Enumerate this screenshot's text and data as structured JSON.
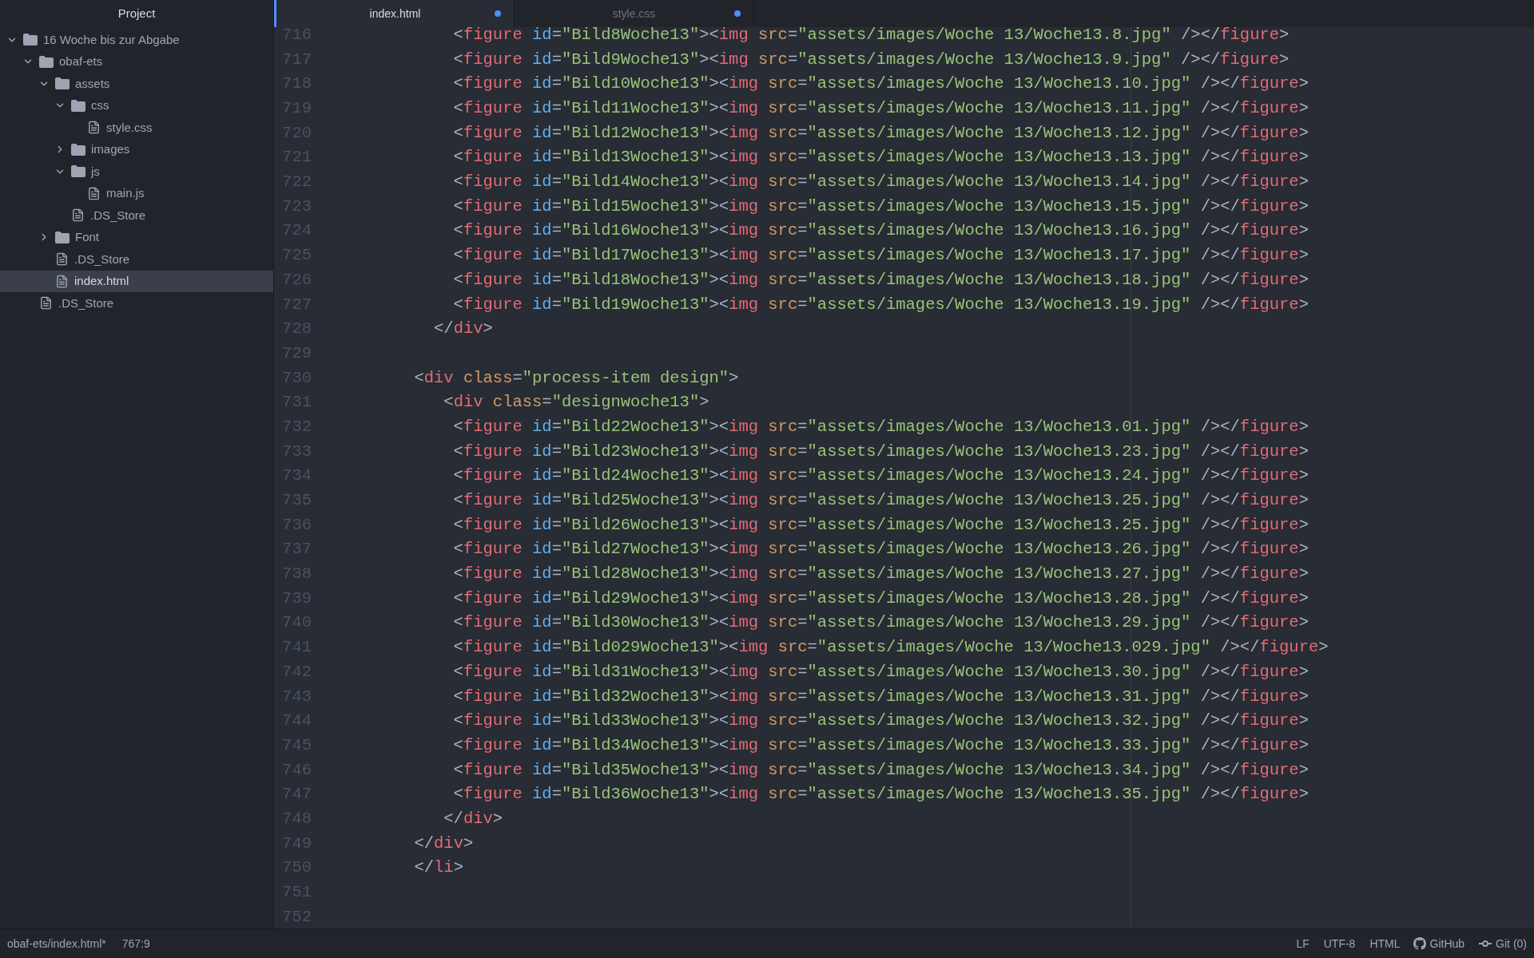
{
  "sidebar": {
    "title": "Project",
    "tree": [
      {
        "kind": "folder",
        "name": "16 Woche bis zur Abgabe",
        "expanded": true,
        "selected": false,
        "children": [
          {
            "kind": "folder",
            "name": "obaf-ets",
            "expanded": true,
            "selected": false,
            "children": [
              {
                "kind": "folder",
                "name": "assets",
                "expanded": true,
                "selected": false,
                "children": [
                  {
                    "kind": "folder",
                    "name": "css",
                    "expanded": true,
                    "selected": false,
                    "children": [
                      {
                        "kind": "file",
                        "name": "style.css",
                        "selected": false
                      }
                    ]
                  },
                  {
                    "kind": "folder",
                    "name": "images",
                    "expanded": false,
                    "selected": false
                  },
                  {
                    "kind": "folder",
                    "name": "js",
                    "expanded": true,
                    "selected": false,
                    "children": [
                      {
                        "kind": "file",
                        "name": "main.js",
                        "selected": false
                      }
                    ]
                  },
                  {
                    "kind": "file",
                    "name": ".DS_Store",
                    "selected": false
                  }
                ]
              },
              {
                "kind": "folder",
                "name": "Font",
                "expanded": false,
                "selected": false
              },
              {
                "kind": "file",
                "name": ".DS_Store",
                "selected": false
              },
              {
                "kind": "file",
                "name": "index.html",
                "selected": true
              }
            ]
          },
          {
            "kind": "file",
            "name": ".DS_Store",
            "selected": false
          }
        ]
      }
    ]
  },
  "tabs": [
    {
      "label": "index.html",
      "selected": true,
      "modified": true
    },
    {
      "label": "style.css",
      "selected": false,
      "modified": true
    }
  ],
  "editor": {
    "lines": [
      {
        "n": "716",
        "code": [
          {
            "kind": "p",
            "text": "            <"
          },
          {
            "kind": "tag",
            "text": "figure"
          },
          {
            "kind": "id",
            "text": " id"
          },
          {
            "kind": "p",
            "text": "="
          },
          {
            "kind": "s",
            "text": "\"Bild8Woche13\""
          },
          {
            "kind": "p",
            "text": "><"
          },
          {
            "kind": "tag",
            "text": "img"
          },
          {
            "kind": "attr",
            "text": " src"
          },
          {
            "kind": "p",
            "text": "="
          },
          {
            "kind": "s",
            "text": "\"assets/images/Woche 13/Woche13.8.jpg\""
          },
          {
            "kind": "p",
            "text": " /></"
          },
          {
            "kind": "tag",
            "text": "figure"
          },
          {
            "kind": "p",
            "text": ">"
          }
        ]
      },
      {
        "n": "717",
        "code": [
          {
            "kind": "p",
            "text": "            <"
          },
          {
            "kind": "tag",
            "text": "figure"
          },
          {
            "kind": "id",
            "text": " id"
          },
          {
            "kind": "p",
            "text": "="
          },
          {
            "kind": "s",
            "text": "\"Bild9Woche13\""
          },
          {
            "kind": "p",
            "text": "><"
          },
          {
            "kind": "tag",
            "text": "img"
          },
          {
            "kind": "attr",
            "text": " src"
          },
          {
            "kind": "p",
            "text": "="
          },
          {
            "kind": "s",
            "text": "\"assets/images/Woche 13/Woche13.9.jpg\""
          },
          {
            "kind": "p",
            "text": " /></"
          },
          {
            "kind": "tag",
            "text": "figure"
          },
          {
            "kind": "p",
            "text": ">"
          }
        ]
      },
      {
        "n": "718",
        "code": [
          {
            "kind": "p",
            "text": "            <"
          },
          {
            "kind": "tag",
            "text": "figure"
          },
          {
            "kind": "id",
            "text": " id"
          },
          {
            "kind": "p",
            "text": "="
          },
          {
            "kind": "s",
            "text": "\"Bild10Woche13\""
          },
          {
            "kind": "p",
            "text": "><"
          },
          {
            "kind": "tag",
            "text": "img"
          },
          {
            "kind": "attr",
            "text": " src"
          },
          {
            "kind": "p",
            "text": "="
          },
          {
            "kind": "s",
            "text": "\"assets/images/Woche 13/Woche13.10.jpg\""
          },
          {
            "kind": "p",
            "text": " /></"
          },
          {
            "kind": "tag",
            "text": "figure"
          },
          {
            "kind": "p",
            "text": ">"
          }
        ]
      },
      {
        "n": "719",
        "code": [
          {
            "kind": "p",
            "text": "            <"
          },
          {
            "kind": "tag",
            "text": "figure"
          },
          {
            "kind": "id",
            "text": " id"
          },
          {
            "kind": "p",
            "text": "="
          },
          {
            "kind": "s",
            "text": "\"Bild11Woche13\""
          },
          {
            "kind": "p",
            "text": "><"
          },
          {
            "kind": "tag",
            "text": "img"
          },
          {
            "kind": "attr",
            "text": " src"
          },
          {
            "kind": "p",
            "text": "="
          },
          {
            "kind": "s",
            "text": "\"assets/images/Woche 13/Woche13.11.jpg\""
          },
          {
            "kind": "p",
            "text": " /></"
          },
          {
            "kind": "tag",
            "text": "figure"
          },
          {
            "kind": "p",
            "text": ">"
          }
        ]
      },
      {
        "n": "720",
        "code": [
          {
            "kind": "p",
            "text": "            <"
          },
          {
            "kind": "tag",
            "text": "figure"
          },
          {
            "kind": "id",
            "text": " id"
          },
          {
            "kind": "p",
            "text": "="
          },
          {
            "kind": "s",
            "text": "\"Bild12Woche13\""
          },
          {
            "kind": "p",
            "text": "><"
          },
          {
            "kind": "tag",
            "text": "img"
          },
          {
            "kind": "attr",
            "text": " src"
          },
          {
            "kind": "p",
            "text": "="
          },
          {
            "kind": "s",
            "text": "\"assets/images/Woche 13/Woche13.12.jpg\""
          },
          {
            "kind": "p",
            "text": " /></"
          },
          {
            "kind": "tag",
            "text": "figure"
          },
          {
            "kind": "p",
            "text": ">"
          }
        ]
      },
      {
        "n": "721",
        "code": [
          {
            "kind": "p",
            "text": "            <"
          },
          {
            "kind": "tag",
            "text": "figure"
          },
          {
            "kind": "id",
            "text": " id"
          },
          {
            "kind": "p",
            "text": "="
          },
          {
            "kind": "s",
            "text": "\"Bild13Woche13\""
          },
          {
            "kind": "p",
            "text": "><"
          },
          {
            "kind": "tag",
            "text": "img"
          },
          {
            "kind": "attr",
            "text": " src"
          },
          {
            "kind": "p",
            "text": "="
          },
          {
            "kind": "s",
            "text": "\"assets/images/Woche 13/Woche13.13.jpg\""
          },
          {
            "kind": "p",
            "text": " /></"
          },
          {
            "kind": "tag",
            "text": "figure"
          },
          {
            "kind": "p",
            "text": ">"
          }
        ]
      },
      {
        "n": "722",
        "code": [
          {
            "kind": "p",
            "text": "            <"
          },
          {
            "kind": "tag",
            "text": "figure"
          },
          {
            "kind": "id",
            "text": " id"
          },
          {
            "kind": "p",
            "text": "="
          },
          {
            "kind": "s",
            "text": "\"Bild14Woche13\""
          },
          {
            "kind": "p",
            "text": "><"
          },
          {
            "kind": "tag",
            "text": "img"
          },
          {
            "kind": "attr",
            "text": " src"
          },
          {
            "kind": "p",
            "text": "="
          },
          {
            "kind": "s",
            "text": "\"assets/images/Woche 13/Woche13.14.jpg\""
          },
          {
            "kind": "p",
            "text": " /></"
          },
          {
            "kind": "tag",
            "text": "figure"
          },
          {
            "kind": "p",
            "text": ">"
          }
        ]
      },
      {
        "n": "723",
        "code": [
          {
            "kind": "p",
            "text": "            <"
          },
          {
            "kind": "tag",
            "text": "figure"
          },
          {
            "kind": "id",
            "text": " id"
          },
          {
            "kind": "p",
            "text": "="
          },
          {
            "kind": "s",
            "text": "\"Bild15Woche13\""
          },
          {
            "kind": "p",
            "text": "><"
          },
          {
            "kind": "tag",
            "text": "img"
          },
          {
            "kind": "attr",
            "text": " src"
          },
          {
            "kind": "p",
            "text": "="
          },
          {
            "kind": "s",
            "text": "\"assets/images/Woche 13/Woche13.15.jpg\""
          },
          {
            "kind": "p",
            "text": " /></"
          },
          {
            "kind": "tag",
            "text": "figure"
          },
          {
            "kind": "p",
            "text": ">"
          }
        ]
      },
      {
        "n": "724",
        "code": [
          {
            "kind": "p",
            "text": "            <"
          },
          {
            "kind": "tag",
            "text": "figure"
          },
          {
            "kind": "id",
            "text": " id"
          },
          {
            "kind": "p",
            "text": "="
          },
          {
            "kind": "s",
            "text": "\"Bild16Woche13\""
          },
          {
            "kind": "p",
            "text": "><"
          },
          {
            "kind": "tag",
            "text": "img"
          },
          {
            "kind": "attr",
            "text": " src"
          },
          {
            "kind": "p",
            "text": "="
          },
          {
            "kind": "s",
            "text": "\"assets/images/Woche 13/Woche13.16.jpg\""
          },
          {
            "kind": "p",
            "text": " /></"
          },
          {
            "kind": "tag",
            "text": "figure"
          },
          {
            "kind": "p",
            "text": ">"
          }
        ]
      },
      {
        "n": "725",
        "code": [
          {
            "kind": "p",
            "text": "            <"
          },
          {
            "kind": "tag",
            "text": "figure"
          },
          {
            "kind": "id",
            "text": " id"
          },
          {
            "kind": "p",
            "text": "="
          },
          {
            "kind": "s",
            "text": "\"Bild17Woche13\""
          },
          {
            "kind": "p",
            "text": "><"
          },
          {
            "kind": "tag",
            "text": "img"
          },
          {
            "kind": "attr",
            "text": " src"
          },
          {
            "kind": "p",
            "text": "="
          },
          {
            "kind": "s",
            "text": "\"assets/images/Woche 13/Woche13.17.jpg\""
          },
          {
            "kind": "p",
            "text": " /></"
          },
          {
            "kind": "tag",
            "text": "figure"
          },
          {
            "kind": "p",
            "text": ">"
          }
        ]
      },
      {
        "n": "726",
        "code": [
          {
            "kind": "p",
            "text": "            <"
          },
          {
            "kind": "tag",
            "text": "figure"
          },
          {
            "kind": "id",
            "text": " id"
          },
          {
            "kind": "p",
            "text": "="
          },
          {
            "kind": "s",
            "text": "\"Bild18Woche13\""
          },
          {
            "kind": "p",
            "text": "><"
          },
          {
            "kind": "tag",
            "text": "img"
          },
          {
            "kind": "attr",
            "text": " src"
          },
          {
            "kind": "p",
            "text": "="
          },
          {
            "kind": "s",
            "text": "\"assets/images/Woche 13/Woche13.18.jpg\""
          },
          {
            "kind": "p",
            "text": " /></"
          },
          {
            "kind": "tag",
            "text": "figure"
          },
          {
            "kind": "p",
            "text": ">"
          }
        ]
      },
      {
        "n": "727",
        "code": [
          {
            "kind": "p",
            "text": "            <"
          },
          {
            "kind": "tag",
            "text": "figure"
          },
          {
            "kind": "id",
            "text": " id"
          },
          {
            "kind": "p",
            "text": "="
          },
          {
            "kind": "s",
            "text": "\"Bild19Woche13\""
          },
          {
            "kind": "p",
            "text": "><"
          },
          {
            "kind": "tag",
            "text": "img"
          },
          {
            "kind": "attr",
            "text": " src"
          },
          {
            "kind": "p",
            "text": "="
          },
          {
            "kind": "s",
            "text": "\"assets/images/Woche 13/Woche13.19.jpg\""
          },
          {
            "kind": "p",
            "text": " /></"
          },
          {
            "kind": "tag",
            "text": "figure"
          },
          {
            "kind": "p",
            "text": ">"
          }
        ]
      },
      {
        "n": "728",
        "code": [
          {
            "kind": "p",
            "text": "          </"
          },
          {
            "kind": "tag",
            "text": "div"
          },
          {
            "kind": "p",
            "text": ">"
          }
        ]
      },
      {
        "n": "729"
      },
      {
        "n": "730",
        "code": [
          {
            "kind": "p",
            "text": "        <"
          },
          {
            "kind": "tag",
            "text": "div"
          },
          {
            "kind": "attr",
            "text": " class"
          },
          {
            "kind": "p",
            "text": "="
          },
          {
            "kind": "s",
            "text": "\"process-item design\""
          },
          {
            "kind": "p",
            "text": ">"
          }
        ]
      },
      {
        "n": "731",
        "code": [
          {
            "kind": "p",
            "text": "           <"
          },
          {
            "kind": "tag",
            "text": "div"
          },
          {
            "kind": "attr",
            "text": " class"
          },
          {
            "kind": "p",
            "text": "="
          },
          {
            "kind": "s",
            "text": "\"designwoche13\""
          },
          {
            "kind": "p",
            "text": ">"
          }
        ]
      },
      {
        "n": "732",
        "code": [
          {
            "kind": "p",
            "text": "            <"
          },
          {
            "kind": "tag",
            "text": "figure"
          },
          {
            "kind": "id",
            "text": " id"
          },
          {
            "kind": "p",
            "text": "="
          },
          {
            "kind": "s",
            "text": "\"Bild22Woche13\""
          },
          {
            "kind": "p",
            "text": "><"
          },
          {
            "kind": "tag",
            "text": "img"
          },
          {
            "kind": "attr",
            "text": " src"
          },
          {
            "kind": "p",
            "text": "="
          },
          {
            "kind": "s",
            "text": "\"assets/images/Woche 13/Woche13.01.jpg\""
          },
          {
            "kind": "p",
            "text": " /></"
          },
          {
            "kind": "tag",
            "text": "figure"
          },
          {
            "kind": "p",
            "text": ">"
          }
        ]
      },
      {
        "n": "733",
        "code": [
          {
            "kind": "p",
            "text": "            <"
          },
          {
            "kind": "tag",
            "text": "figure"
          },
          {
            "kind": "id",
            "text": " id"
          },
          {
            "kind": "p",
            "text": "="
          },
          {
            "kind": "s",
            "text": "\"Bild23Woche13\""
          },
          {
            "kind": "p",
            "text": "><"
          },
          {
            "kind": "tag",
            "text": "img"
          },
          {
            "kind": "attr",
            "text": " src"
          },
          {
            "kind": "p",
            "text": "="
          },
          {
            "kind": "s",
            "text": "\"assets/images/Woche 13/Woche13.23.jpg\""
          },
          {
            "kind": "p",
            "text": " /></"
          },
          {
            "kind": "tag",
            "text": "figure"
          },
          {
            "kind": "p",
            "text": ">"
          }
        ]
      },
      {
        "n": "734",
        "code": [
          {
            "kind": "p",
            "text": "            <"
          },
          {
            "kind": "tag",
            "text": "figure"
          },
          {
            "kind": "id",
            "text": " id"
          },
          {
            "kind": "p",
            "text": "="
          },
          {
            "kind": "s",
            "text": "\"Bild24Woche13\""
          },
          {
            "kind": "p",
            "text": "><"
          },
          {
            "kind": "tag",
            "text": "img"
          },
          {
            "kind": "attr",
            "text": " src"
          },
          {
            "kind": "p",
            "text": "="
          },
          {
            "kind": "s",
            "text": "\"assets/images/Woche 13/Woche13.24.jpg\""
          },
          {
            "kind": "p",
            "text": " /></"
          },
          {
            "kind": "tag",
            "text": "figure"
          },
          {
            "kind": "p",
            "text": ">"
          }
        ]
      },
      {
        "n": "735",
        "code": [
          {
            "kind": "p",
            "text": "            <"
          },
          {
            "kind": "tag",
            "text": "figure"
          },
          {
            "kind": "id",
            "text": " id"
          },
          {
            "kind": "p",
            "text": "="
          },
          {
            "kind": "s",
            "text": "\"Bild25Woche13\""
          },
          {
            "kind": "p",
            "text": "><"
          },
          {
            "kind": "tag",
            "text": "img"
          },
          {
            "kind": "attr",
            "text": " src"
          },
          {
            "kind": "p",
            "text": "="
          },
          {
            "kind": "s",
            "text": "\"assets/images/Woche 13/Woche13.25.jpg\""
          },
          {
            "kind": "p",
            "text": " /></"
          },
          {
            "kind": "tag",
            "text": "figure"
          },
          {
            "kind": "p",
            "text": ">"
          }
        ]
      },
      {
        "n": "736",
        "code": [
          {
            "kind": "p",
            "text": "            <"
          },
          {
            "kind": "tag",
            "text": "figure"
          },
          {
            "kind": "id",
            "text": " id"
          },
          {
            "kind": "p",
            "text": "="
          },
          {
            "kind": "s",
            "text": "\"Bild26Woche13\""
          },
          {
            "kind": "p",
            "text": "><"
          },
          {
            "kind": "tag",
            "text": "img"
          },
          {
            "kind": "attr",
            "text": " src"
          },
          {
            "kind": "p",
            "text": "="
          },
          {
            "kind": "s",
            "text": "\"assets/images/Woche 13/Woche13.25.jpg\""
          },
          {
            "kind": "p",
            "text": " /></"
          },
          {
            "kind": "tag",
            "text": "figure"
          },
          {
            "kind": "p",
            "text": ">"
          }
        ]
      },
      {
        "n": "737",
        "code": [
          {
            "kind": "p",
            "text": "            <"
          },
          {
            "kind": "tag",
            "text": "figure"
          },
          {
            "kind": "id",
            "text": " id"
          },
          {
            "kind": "p",
            "text": "="
          },
          {
            "kind": "s",
            "text": "\"Bild27Woche13\""
          },
          {
            "kind": "p",
            "text": "><"
          },
          {
            "kind": "tag",
            "text": "img"
          },
          {
            "kind": "attr",
            "text": " src"
          },
          {
            "kind": "p",
            "text": "="
          },
          {
            "kind": "s",
            "text": "\"assets/images/Woche 13/Woche13.26.jpg\""
          },
          {
            "kind": "p",
            "text": " /></"
          },
          {
            "kind": "tag",
            "text": "figure"
          },
          {
            "kind": "p",
            "text": ">"
          }
        ]
      },
      {
        "n": "738",
        "code": [
          {
            "kind": "p",
            "text": "            <"
          },
          {
            "kind": "tag",
            "text": "figure"
          },
          {
            "kind": "id",
            "text": " id"
          },
          {
            "kind": "p",
            "text": "="
          },
          {
            "kind": "s",
            "text": "\"Bild28Woche13\""
          },
          {
            "kind": "p",
            "text": "><"
          },
          {
            "kind": "tag",
            "text": "img"
          },
          {
            "kind": "attr",
            "text": " src"
          },
          {
            "kind": "p",
            "text": "="
          },
          {
            "kind": "s",
            "text": "\"assets/images/Woche 13/Woche13.27.jpg\""
          },
          {
            "kind": "p",
            "text": " /></"
          },
          {
            "kind": "tag",
            "text": "figure"
          },
          {
            "kind": "p",
            "text": ">"
          }
        ]
      },
      {
        "n": "739",
        "code": [
          {
            "kind": "p",
            "text": "            <"
          },
          {
            "kind": "tag",
            "text": "figure"
          },
          {
            "kind": "id",
            "text": " id"
          },
          {
            "kind": "p",
            "text": "="
          },
          {
            "kind": "s",
            "text": "\"Bild29Woche13\""
          },
          {
            "kind": "p",
            "text": "><"
          },
          {
            "kind": "tag",
            "text": "img"
          },
          {
            "kind": "attr",
            "text": " src"
          },
          {
            "kind": "p",
            "text": "="
          },
          {
            "kind": "s",
            "text": "\"assets/images/Woche 13/Woche13.28.jpg\""
          },
          {
            "kind": "p",
            "text": " /></"
          },
          {
            "kind": "tag",
            "text": "figure"
          },
          {
            "kind": "p",
            "text": ">"
          }
        ]
      },
      {
        "n": "740",
        "code": [
          {
            "kind": "p",
            "text": "            <"
          },
          {
            "kind": "tag",
            "text": "figure"
          },
          {
            "kind": "id",
            "text": " id"
          },
          {
            "kind": "p",
            "text": "="
          },
          {
            "kind": "s",
            "text": "\"Bild30Woche13\""
          },
          {
            "kind": "p",
            "text": "><"
          },
          {
            "kind": "tag",
            "text": "img"
          },
          {
            "kind": "attr",
            "text": " src"
          },
          {
            "kind": "p",
            "text": "="
          },
          {
            "kind": "s",
            "text": "\"assets/images/Woche 13/Woche13.29.jpg\""
          },
          {
            "kind": "p",
            "text": " /></"
          },
          {
            "kind": "tag",
            "text": "figure"
          },
          {
            "kind": "p",
            "text": ">"
          }
        ]
      },
      {
        "n": "741",
        "code": [
          {
            "kind": "p",
            "text": "            <"
          },
          {
            "kind": "tag",
            "text": "figure"
          },
          {
            "kind": "id",
            "text": " id"
          },
          {
            "kind": "p",
            "text": "="
          },
          {
            "kind": "s",
            "text": "\"Bild029Woche13\""
          },
          {
            "kind": "p",
            "text": "><"
          },
          {
            "kind": "tag",
            "text": "img"
          },
          {
            "kind": "attr",
            "text": " src"
          },
          {
            "kind": "p",
            "text": "="
          },
          {
            "kind": "s",
            "text": "\"assets/images/Woche 13/Woche13.029.jpg\""
          },
          {
            "kind": "p",
            "text": " /></"
          },
          {
            "kind": "tag",
            "text": "figure"
          },
          {
            "kind": "p",
            "text": ">"
          }
        ]
      },
      {
        "n": "742",
        "code": [
          {
            "kind": "p",
            "text": "            <"
          },
          {
            "kind": "tag",
            "text": "figure"
          },
          {
            "kind": "id",
            "text": " id"
          },
          {
            "kind": "p",
            "text": "="
          },
          {
            "kind": "s",
            "text": "\"Bild31Woche13\""
          },
          {
            "kind": "p",
            "text": "><"
          },
          {
            "kind": "tag",
            "text": "img"
          },
          {
            "kind": "attr",
            "text": " src"
          },
          {
            "kind": "p",
            "text": "="
          },
          {
            "kind": "s",
            "text": "\"assets/images/Woche 13/Woche13.30.jpg\""
          },
          {
            "kind": "p",
            "text": " /></"
          },
          {
            "kind": "tag",
            "text": "figure"
          },
          {
            "kind": "p",
            "text": ">"
          }
        ]
      },
      {
        "n": "743",
        "code": [
          {
            "kind": "p",
            "text": "            <"
          },
          {
            "kind": "tag",
            "text": "figure"
          },
          {
            "kind": "id",
            "text": " id"
          },
          {
            "kind": "p",
            "text": "="
          },
          {
            "kind": "s",
            "text": "\"Bild32Woche13\""
          },
          {
            "kind": "p",
            "text": "><"
          },
          {
            "kind": "tag",
            "text": "img"
          },
          {
            "kind": "attr",
            "text": " src"
          },
          {
            "kind": "p",
            "text": "="
          },
          {
            "kind": "s",
            "text": "\"assets/images/Woche 13/Woche13.31.jpg\""
          },
          {
            "kind": "p",
            "text": " /></"
          },
          {
            "kind": "tag",
            "text": "figure"
          },
          {
            "kind": "p",
            "text": ">"
          }
        ]
      },
      {
        "n": "744",
        "code": [
          {
            "kind": "p",
            "text": "            <"
          },
          {
            "kind": "tag",
            "text": "figure"
          },
          {
            "kind": "id",
            "text": " id"
          },
          {
            "kind": "p",
            "text": "="
          },
          {
            "kind": "s",
            "text": "\"Bild33Woche13\""
          },
          {
            "kind": "p",
            "text": "><"
          },
          {
            "kind": "tag",
            "text": "img"
          },
          {
            "kind": "attr",
            "text": " src"
          },
          {
            "kind": "p",
            "text": "="
          },
          {
            "kind": "s",
            "text": "\"assets/images/Woche 13/Woche13.32.jpg\""
          },
          {
            "kind": "p",
            "text": " /></"
          },
          {
            "kind": "tag",
            "text": "figure"
          },
          {
            "kind": "p",
            "text": ">"
          }
        ]
      },
      {
        "n": "745",
        "code": [
          {
            "kind": "p",
            "text": "            <"
          },
          {
            "kind": "tag",
            "text": "figure"
          },
          {
            "kind": "id",
            "text": " id"
          },
          {
            "kind": "p",
            "text": "="
          },
          {
            "kind": "s",
            "text": "\"Bild34Woche13\""
          },
          {
            "kind": "p",
            "text": "><"
          },
          {
            "kind": "tag",
            "text": "img"
          },
          {
            "kind": "attr",
            "text": " src"
          },
          {
            "kind": "p",
            "text": "="
          },
          {
            "kind": "s",
            "text": "\"assets/images/Woche 13/Woche13.33.jpg\""
          },
          {
            "kind": "p",
            "text": " /></"
          },
          {
            "kind": "tag",
            "text": "figure"
          },
          {
            "kind": "p",
            "text": ">"
          }
        ]
      },
      {
        "n": "746",
        "code": [
          {
            "kind": "p",
            "text": "            <"
          },
          {
            "kind": "tag",
            "text": "figure"
          },
          {
            "kind": "id",
            "text": " id"
          },
          {
            "kind": "p",
            "text": "="
          },
          {
            "kind": "s",
            "text": "\"Bild35Woche13\""
          },
          {
            "kind": "p",
            "text": "><"
          },
          {
            "kind": "tag",
            "text": "img"
          },
          {
            "kind": "attr",
            "text": " src"
          },
          {
            "kind": "p",
            "text": "="
          },
          {
            "kind": "s",
            "text": "\"assets/images/Woche 13/Woche13.34.jpg\""
          },
          {
            "kind": "p",
            "text": " /></"
          },
          {
            "kind": "tag",
            "text": "figure"
          },
          {
            "kind": "p",
            "text": ">"
          }
        ]
      },
      {
        "n": "747",
        "code": [
          {
            "kind": "p",
            "text": "            <"
          },
          {
            "kind": "tag",
            "text": "figure"
          },
          {
            "kind": "id",
            "text": " id"
          },
          {
            "kind": "p",
            "text": "="
          },
          {
            "kind": "s",
            "text": "\"Bild36Woche13\""
          },
          {
            "kind": "p",
            "text": "><"
          },
          {
            "kind": "tag",
            "text": "img"
          },
          {
            "kind": "attr",
            "text": " src"
          },
          {
            "kind": "p",
            "text": "="
          },
          {
            "kind": "s",
            "text": "\"assets/images/Woche 13/Woche13.35.jpg\""
          },
          {
            "kind": "p",
            "text": " /></"
          },
          {
            "kind": "tag",
            "text": "figure"
          },
          {
            "kind": "p",
            "text": ">"
          }
        ]
      },
      {
        "n": "748",
        "code": [
          {
            "kind": "p",
            "text": "           </"
          },
          {
            "kind": "tag",
            "text": "div"
          },
          {
            "kind": "p",
            "text": ">"
          }
        ]
      },
      {
        "n": "749",
        "code": [
          {
            "kind": "p",
            "text": "        </"
          },
          {
            "kind": "tag",
            "text": "div"
          },
          {
            "kind": "p",
            "text": ">"
          }
        ]
      },
      {
        "n": "750",
        "code": [
          {
            "kind": "p",
            "text": "        </"
          },
          {
            "kind": "tag",
            "text": "li"
          },
          {
            "kind": "p",
            "text": ">"
          }
        ]
      },
      {
        "n": "751"
      },
      {
        "n": "752"
      }
    ]
  },
  "status_bar": {
    "file": "obaf-ets/index.html*",
    "cursor": "767:9",
    "line_ending": "LF",
    "encoding": "UTF-8",
    "grammar": "HTML",
    "github": "GitHub",
    "git": "Git (0)"
  }
}
